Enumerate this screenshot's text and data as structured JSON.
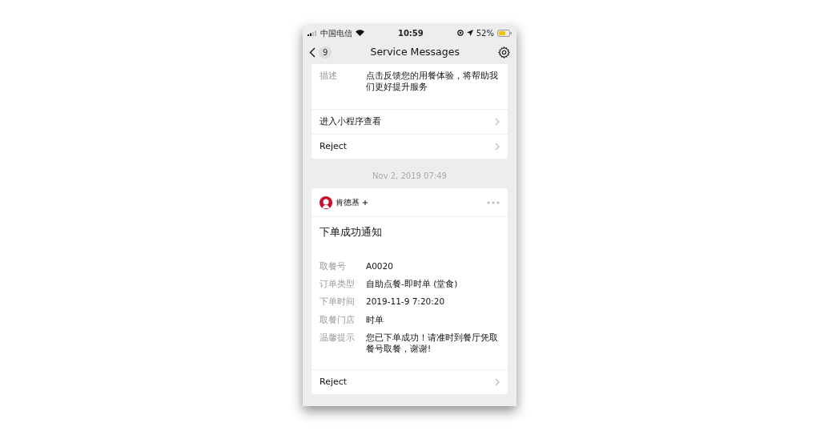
{
  "status_bar": {
    "carrier": "中国电信",
    "time": "10:59",
    "battery": "52%"
  },
  "nav": {
    "back_count": "9",
    "title": "Service Messages"
  },
  "messages": [
    {
      "fields": [
        {
          "label": "描述",
          "value": "点击反馈您的用餐体验，将帮助我们更好提升服务"
        }
      ],
      "actions": [
        "进入小程序查看",
        "Reject"
      ]
    },
    {
      "timestamp": "Nov 2, 2019 07:49",
      "sender": "肯德基",
      "title": "下单成功通知",
      "fields": [
        {
          "label": "取餐号",
          "value": "A0020"
        },
        {
          "label": "订单类型",
          "value": "自助点餐-即时单 (堂食)"
        },
        {
          "label": "下单时间",
          "value": "2019-11-9 7:20:20"
        },
        {
          "label": "取餐门店",
          "value": "时单"
        },
        {
          "label": "温馨提示",
          "value": "您已下单成功！请准时到餐厅凭取餐号取餐，谢谢!"
        }
      ],
      "actions": [
        "Reject"
      ]
    }
  ]
}
